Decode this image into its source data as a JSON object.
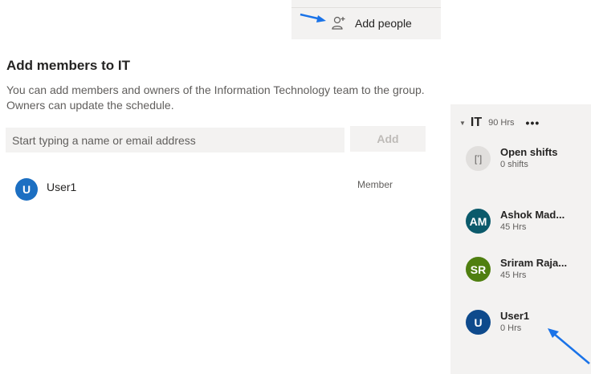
{
  "menu": {
    "add_people_label": "Add people"
  },
  "dialog": {
    "title": "Add members to IT",
    "description": "You can add members and owners of the Information Technology team to the group. Owners can update the schedule.",
    "search_placeholder": "Start typing a name or email address",
    "add_button_label": "Add",
    "members": [
      {
        "initial": "U",
        "name": "User1",
        "role": "Member"
      }
    ]
  },
  "team": {
    "name": "IT",
    "hours": "90 Hrs",
    "more_label": "•••",
    "open_shifts": {
      "icon": "[ʽ]",
      "name": "Open shifts",
      "sub": "0 shifts"
    },
    "people": [
      {
        "initials": "AM",
        "name": "Ashok Mad...",
        "hours": "45 Hrs",
        "color": "#0b5a6b"
      },
      {
        "initials": "SR",
        "name": "Sriram Raja...",
        "hours": "45 Hrs",
        "color": "#4f7f10"
      },
      {
        "initials": "U",
        "name": "User1",
        "hours": "0 Hrs",
        "color": "#0e4a8c"
      }
    ]
  },
  "colors": {
    "accent": "#1c6fc2",
    "panel": "#f3f2f1",
    "arrow": "#1a73e8"
  }
}
